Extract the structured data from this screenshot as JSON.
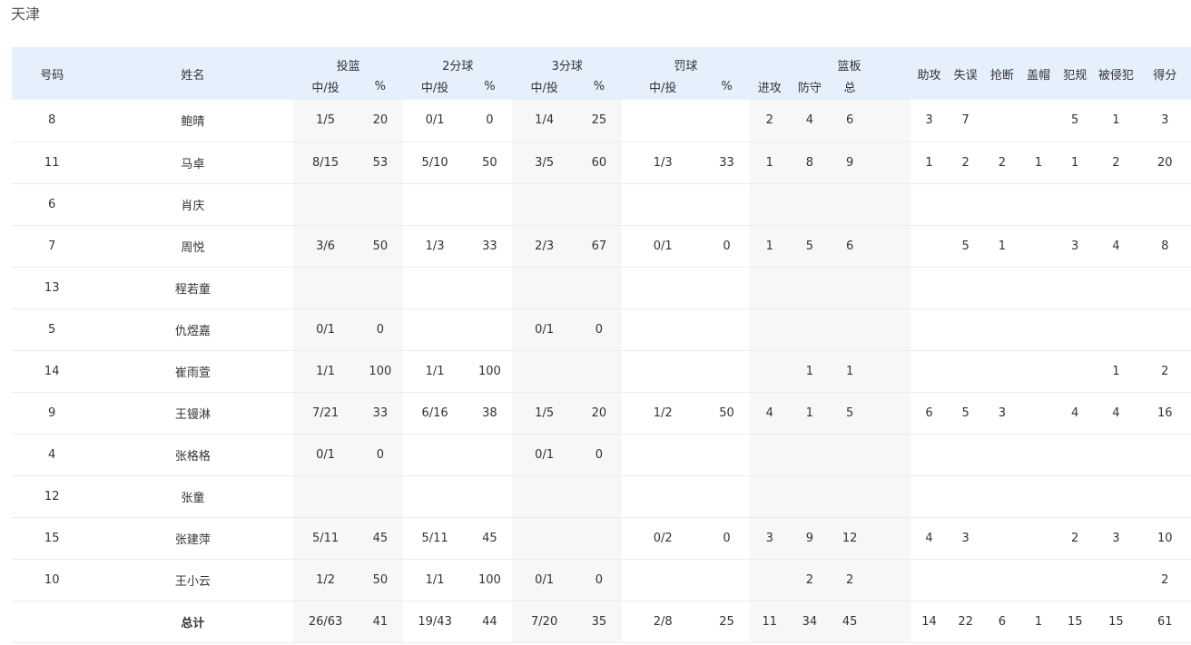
{
  "team": "天津",
  "headers": {
    "number": "号码",
    "name": "姓名",
    "fg": "投篮",
    "two": "2分球",
    "three": "3分球",
    "ft": "罚球",
    "reb": "篮板",
    "made_att": "中/投",
    "pct": "%",
    "off": "进攻",
    "def": "防守",
    "tot": "总",
    "ast": "助攻",
    "to": "失误",
    "stl": "抢断",
    "blk": "盖帽",
    "pf": "犯规",
    "fd": "被侵犯",
    "pts": "得分"
  },
  "rows": [
    [
      "8",
      "鲍晴",
      "1/5",
      "20",
      "0/1",
      "0",
      "1/4",
      "25",
      "",
      "",
      "2",
      "4",
      "6",
      "3",
      "7",
      "",
      "",
      "5",
      "1",
      "3"
    ],
    [
      "11",
      "马卓",
      "8/15",
      "53",
      "5/10",
      "50",
      "3/5",
      "60",
      "1/3",
      "33",
      "1",
      "8",
      "9",
      "1",
      "2",
      "2",
      "1",
      "1",
      "2",
      "20"
    ],
    [
      "6",
      "肖庆",
      "",
      "",
      "",
      "",
      "",
      "",
      "",
      "",
      "",
      "",
      "",
      "",
      "",
      "",
      "",
      "",
      "",
      ""
    ],
    [
      "7",
      "周悦",
      "3/6",
      "50",
      "1/3",
      "33",
      "2/3",
      "67",
      "0/1",
      "0",
      "1",
      "5",
      "6",
      "",
      "5",
      "1",
      "",
      "3",
      "4",
      "8"
    ],
    [
      "13",
      "程若童",
      "",
      "",
      "",
      "",
      "",
      "",
      "",
      "",
      "",
      "",
      "",
      "",
      "",
      "",
      "",
      "",
      "",
      ""
    ],
    [
      "5",
      "仇煜嘉",
      "0/1",
      "0",
      "",
      "",
      "0/1",
      "0",
      "",
      "",
      "",
      "",
      "",
      "",
      "",
      "",
      "",
      "",
      "",
      ""
    ],
    [
      "14",
      "崔雨萱",
      "1/1",
      "100",
      "1/1",
      "100",
      "",
      "",
      "",
      "",
      "",
      "1",
      "1",
      "",
      "",
      "",
      "",
      "",
      "1",
      "2"
    ],
    [
      "9",
      "王镘淋",
      "7/21",
      "33",
      "6/16",
      "38",
      "1/5",
      "20",
      "1/2",
      "50",
      "4",
      "1",
      "5",
      "6",
      "5",
      "3",
      "",
      "4",
      "4",
      "16"
    ],
    [
      "4",
      "张格格",
      "0/1",
      "0",
      "",
      "",
      "0/1",
      "0",
      "",
      "",
      "",
      "",
      "",
      "",
      "",
      "",
      "",
      "",
      "",
      ""
    ],
    [
      "12",
      "张童",
      "",
      "",
      "",
      "",
      "",
      "",
      "",
      "",
      "",
      "",
      "",
      "",
      "",
      "",
      "",
      "",
      "",
      ""
    ],
    [
      "15",
      "张建萍",
      "5/11",
      "45",
      "5/11",
      "45",
      "",
      "",
      "0/2",
      "0",
      "3",
      "9",
      "12",
      "4",
      "3",
      "",
      "",
      "2",
      "3",
      "10"
    ],
    [
      "10",
      "王小云",
      "1/2",
      "50",
      "1/1",
      "100",
      "0/1",
      "0",
      "",
      "",
      "",
      "2",
      "2",
      "",
      "",
      "",
      "",
      "",
      "",
      "2"
    ]
  ],
  "total": [
    "",
    "总计",
    "26/63",
    "41",
    "19/43",
    "44",
    "7/20",
    "35",
    "2/8",
    "25",
    "11",
    "34",
    "45",
    "14",
    "22",
    "6",
    "1",
    "15",
    "15",
    "61"
  ],
  "colors": {
    "header_bg": "#e6f0fd",
    "shade": "#f7f7f7",
    "row_border": "#ececec"
  }
}
